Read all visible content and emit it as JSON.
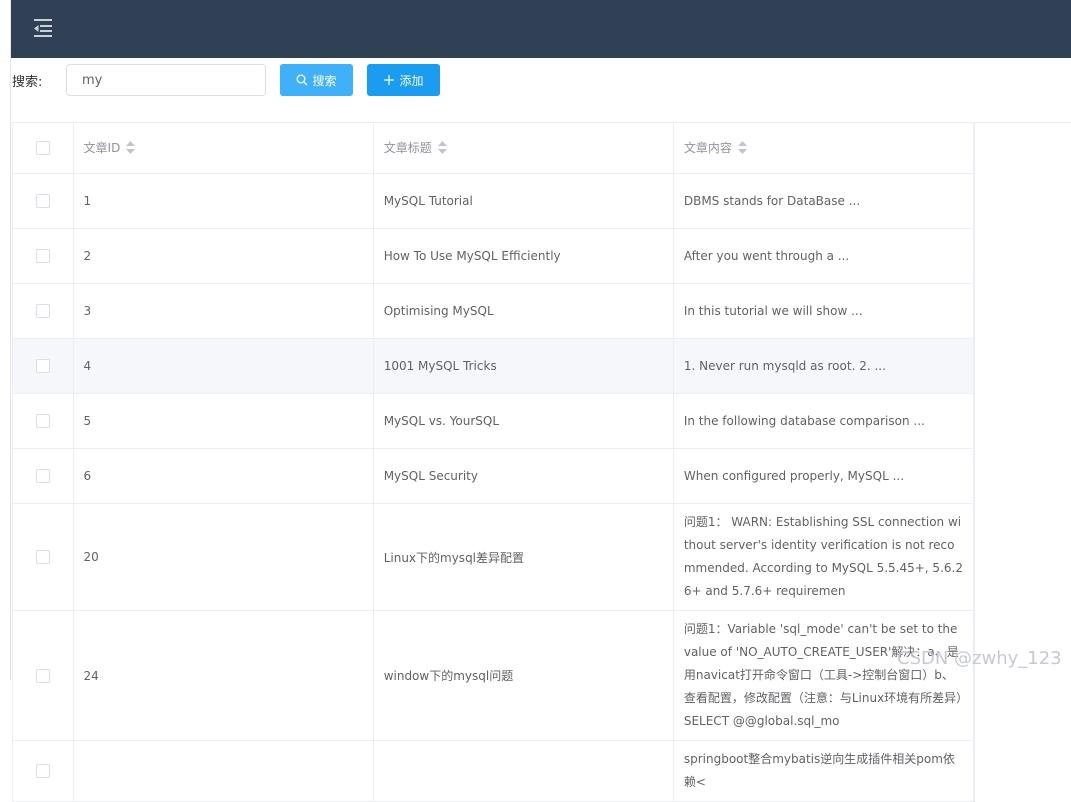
{
  "header": {
    "menu_icon": "menu-fold-icon"
  },
  "toolbar": {
    "search_label": "搜索:",
    "search_value": "my",
    "search_button": "搜索",
    "add_button": "添加",
    "colors": {
      "search_btn": "#40b0f9",
      "add_btn": "#1a9cf0",
      "topbar": "#304156"
    }
  },
  "table": {
    "columns": [
      "文章ID",
      "文章标题",
      "文章内容"
    ],
    "rows": [
      {
        "id": "1",
        "title": "MySQL Tutorial",
        "content": "DBMS stands for DataBase ..."
      },
      {
        "id": "2",
        "title": "How To Use MySQL Efficiently",
        "content": "After you went through a ..."
      },
      {
        "id": "3",
        "title": "Optimising MySQL",
        "content": "In this tutorial we will show ..."
      },
      {
        "id": "4",
        "title": "1001 MySQL Tricks",
        "content": "1. Never run mysqld as root. 2. ..."
      },
      {
        "id": "5",
        "title": "MySQL vs. YourSQL",
        "content": "In the following database comparison ..."
      },
      {
        "id": "6",
        "title": "MySQL Security",
        "content": "When configured properly, MySQL ..."
      },
      {
        "id": "20",
        "title": "Linux下的mysql差异配置",
        "content": "问题1： WARN: Establishing SSL connection without server's identity verification is not recommended. According to MySQL 5.5.45+, 5.6.26+ and 5.7.6+ requiremen"
      },
      {
        "id": "24",
        "title": "window下的mysql问题",
        "content": "问题1：Variable 'sql_mode' can't be set to the value of 'NO_AUTO_CREATE_USER'解决：a、是用navicat打开命令窗口（工具->控制台窗口）b、查看配置，修改配置（注意：与Linux环境有所差异）SELECT @@global.sql_mo"
      },
      {
        "id": "",
        "title": "",
        "content": "springboot整合mybatis逆向生成插件相关pom依赖<"
      }
    ]
  },
  "watermark": "CSDN @zwhy_123"
}
